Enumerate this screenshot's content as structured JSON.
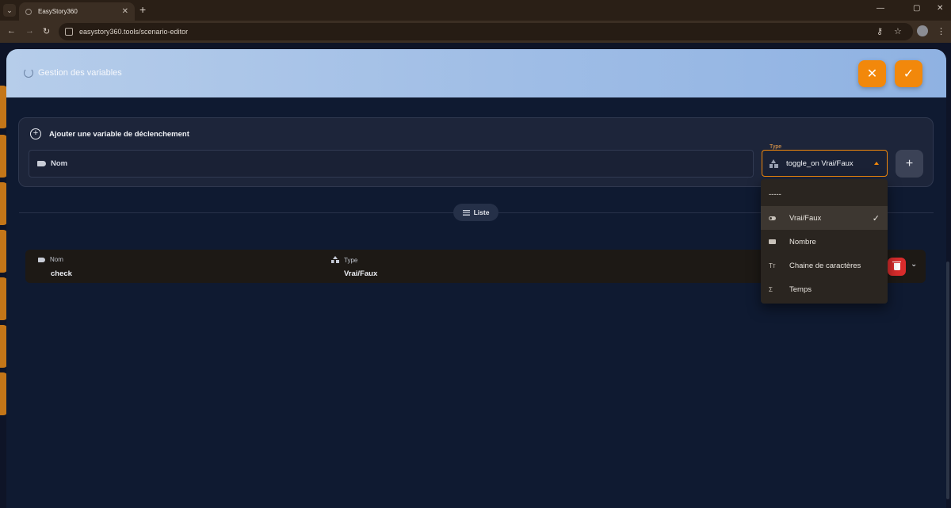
{
  "browser": {
    "tab_title": "EasyStory360",
    "url": "easystory360.tools/scenario-editor",
    "icons": {
      "tab_menu": "chevron-down-icon",
      "tab_close": "close-icon",
      "new_tab": "plus-icon",
      "minimize": "minimize-icon",
      "maximize": "maximize-icon",
      "close_window": "close-icon",
      "back": "arrow-left-icon",
      "forward": "arrow-right-icon",
      "reload": "reload-icon",
      "password": "key-icon",
      "bookmark": "star-icon",
      "profile": "avatar-icon",
      "menu": "more-vertical-icon"
    },
    "glyphs": {
      "tab_menu": "⌄",
      "tab_close": "✕",
      "new_tab": "+",
      "minimize": "—",
      "maximize": "▢",
      "close_window": "✕",
      "back": "←",
      "forward": "→",
      "reload": "↻",
      "password": "⚷",
      "bookmark": "☆",
      "menu": "⋮"
    }
  },
  "modal": {
    "title": "Gestion des variables",
    "cancel_glyph": "✕",
    "confirm_glyph": "✓",
    "accent_color": "#f2880b"
  },
  "add_variable": {
    "title": "Ajouter une variable de déclenchement",
    "plus_glyph": "+",
    "name_placeholder": "Nom",
    "type_label": "Type",
    "type_value": "toggle_on Vrai/Faux",
    "add_glyph": "+"
  },
  "list_chip": {
    "label": "Liste"
  },
  "table": {
    "headers": {
      "name": "Nom",
      "type": "Type"
    },
    "rows": [
      {
        "name": "check",
        "type": "Vrai/Faux"
      }
    ],
    "expand_glyph": "⌄",
    "delete_color": "#d92c2c"
  },
  "dropdown": {
    "options": [
      {
        "label": "-----",
        "icon": ""
      },
      {
        "label": "Vrai/Faux",
        "icon": "toggle-icon",
        "selected": true
      },
      {
        "label": "Nombre",
        "icon": "number-icon"
      },
      {
        "label": "Chaine de caractères",
        "icon": "text-icon",
        "glyph": "Tт"
      },
      {
        "label": "Temps",
        "icon": "sigma-icon",
        "glyph": "Σ"
      }
    ],
    "check_glyph": "✓"
  }
}
